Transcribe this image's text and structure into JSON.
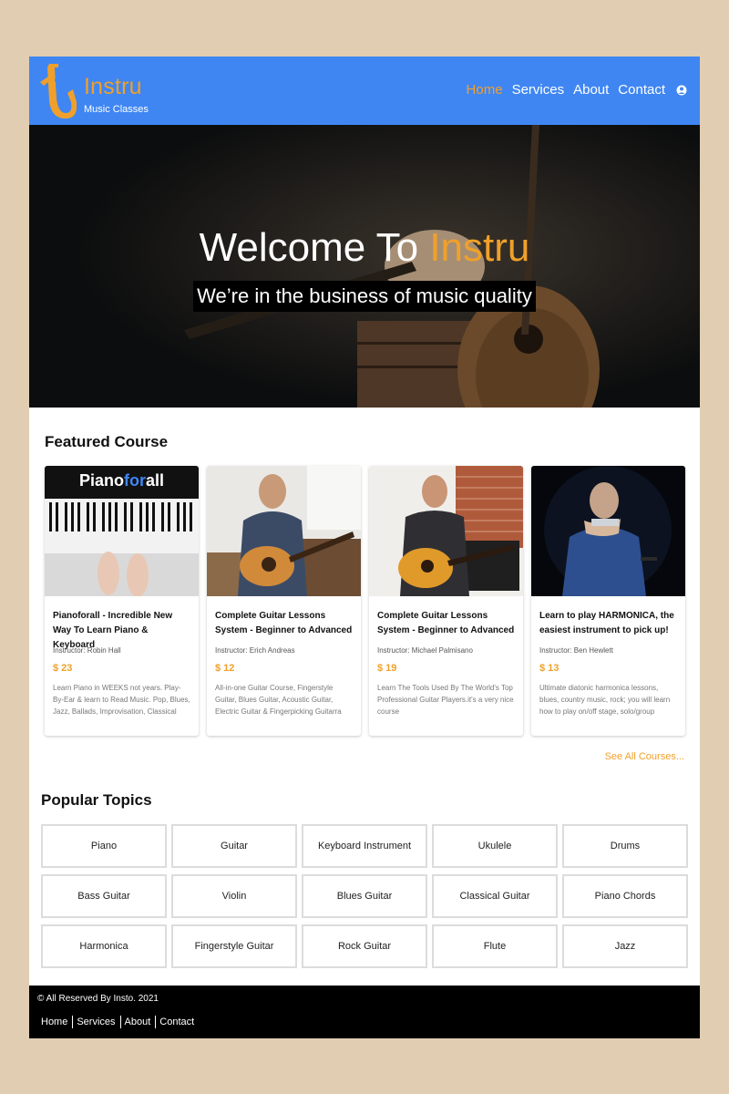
{
  "brand": {
    "name": "Instru",
    "tagline": "Music Classes",
    "accent": "#f0a02a",
    "nav_bg": "#3f86f3"
  },
  "nav": [
    {
      "label": "Home",
      "active": true
    },
    {
      "label": "Services"
    },
    {
      "label": "About"
    },
    {
      "label": "Contact"
    }
  ],
  "nav_icon": "user-icon",
  "hero": {
    "title_prefix": "Welcome To ",
    "title_accent": "Instru",
    "subtitle": "We’re in the business of music quality"
  },
  "featured": {
    "heading": "Featured Course",
    "cards": [
      {
        "title": "Pianoforall - Incredible New Way To Learn Piano & Keyboard",
        "instructor": "Instructor: Robin Hall",
        "price": "$ 23",
        "description": "Learn Piano in WEEKS not years. Play-By-Ear & learn to Read Music. Pop, Blues, Jazz, Ballads, Improvisation, Classical",
        "image_text": [
          "Piano",
          "for",
          "all"
        ]
      },
      {
        "title": "Complete Guitar Lessons System - Beginner to Advanced",
        "instructor": "Instructor: Erich Andreas",
        "price": "$ 12",
        "description": "All-in-one Guitar Course, Fingerstyle Guitar, Blues Guitar, Acoustic Guitar, Electric Guitar & Fingerpicking Guitarra"
      },
      {
        "title": "Complete Guitar Lessons System - Beginner to Advanced",
        "instructor": "Instructor: Michael Palmisano",
        "price": "$ 19",
        "description": "Learn The Tools Used By The World's Top Professional Guitar Players.it's a very nice course"
      },
      {
        "title": "Learn to play HARMONICA, the easiest instrument to pick up!",
        "instructor": "Instructor: Ben Hewlett",
        "price": "$ 13",
        "description": "Ultimate diatonic harmonica lessons, blues, country music, rock; you will learn how to play on/off stage, solo/group"
      }
    ],
    "see_all": "See All Courses..."
  },
  "topics": {
    "heading": "Popular Topics",
    "items": [
      "Piano",
      "Guitar",
      "Keyboard Instrument",
      "Ukulele",
      "Drums",
      "Bass Guitar",
      "Violin",
      "Blues Guitar",
      "Classical Guitar",
      "Piano Chords",
      "Harmonica",
      "Fingerstyle Guitar",
      "Rock Guitar",
      "Flute",
      "Jazz"
    ]
  },
  "footer": {
    "copyright": "© All Reserved By Insto. 2021",
    "links": [
      "Home",
      "Services",
      "About",
      "Contact"
    ]
  }
}
